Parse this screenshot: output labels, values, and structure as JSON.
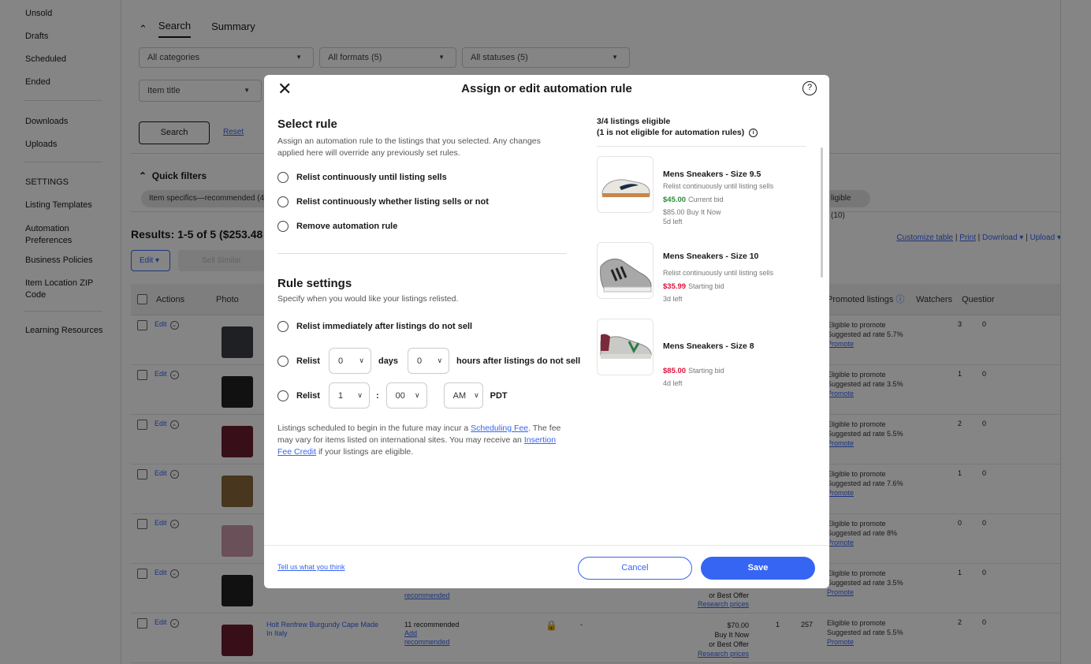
{
  "sidebar": {
    "items": [
      "Unsold",
      "Drafts",
      "Scheduled",
      "Ended"
    ],
    "items2": [
      "Downloads",
      "Uploads"
    ],
    "settings_heading": "SETTINGS",
    "settings": [
      "Listing Templates",
      "Automation Preferences",
      "Business Policies",
      "Item Location ZIP Code"
    ],
    "learning": "Learning Resources"
  },
  "main": {
    "tabs": [
      "Search",
      "Summary"
    ],
    "category": "All categories",
    "formats": "All formats (5)",
    "statuses": "All statuses (5)",
    "field": "Item title",
    "search_button": "Search",
    "reset": "Reset",
    "quick_filters": "Quick filters",
    "chip_left": "Item specifics—recommended (4",
    "chip_right": "ligible (10)",
    "results": "Results: 1-5 of 5 ($253.48",
    "edit_menu": "Edit",
    "sell_similar": "Sell Similar",
    "right_links": {
      "customize": "Customize table",
      "print": "Print",
      "download": "Download",
      "upload": "Upload"
    },
    "columns": {
      "actions": "Actions",
      "photo": "Photo",
      "promoted": "Promoted listings",
      "watchers": "Watchers",
      "questions": "Questior"
    },
    "rows": [
      {
        "edit": "Edit",
        "p1": "Eligible to promote",
        "p2": "Suggested ad rate 5.7%",
        "p3": "Promote",
        "w": "3",
        "q": "0"
      },
      {
        "edit": "Edit",
        "p1": "Eligible to promote",
        "p2": "Suggested ad rate 3.5%",
        "p3": "Promote",
        "w": "1",
        "q": "0"
      },
      {
        "edit": "Edit",
        "p1": "Eligible to promote",
        "p2": "Suggested ad rate 5.5%",
        "p3": "Promote",
        "w": "2",
        "q": "0"
      },
      {
        "edit": "Edit",
        "p1": "Eligible to promote",
        "p2": "Suggested ad rate 7.6%",
        "p3": "Promote",
        "w": "1",
        "q": "0"
      },
      {
        "edit": "Edit",
        "p1": "Eligible to promote",
        "p2": "Suggested ad rate 8%",
        "p3": "Promote",
        "w": "0",
        "q": "0"
      },
      {
        "edit": "Edit",
        "p1": "Eligible to promote",
        "p2": "Suggested ad rate 3.5%",
        "p3": "Promote",
        "w": "1",
        "q": "0"
      },
      {
        "edit": "Edit",
        "p1": "Eligible to promote",
        "p2": "Suggested ad rate 5.5%",
        "p3": "Promote",
        "w": "2",
        "q": "0"
      }
    ],
    "row6_extra": {
      "rec": "recommended",
      "best": "or Best Offer",
      "research": "Research prices"
    },
    "row7": {
      "title": "Holt Renfrew Burgundy Cape Made In Italy",
      "rec": "11 recommended",
      "add": "Add",
      "rec2": "recommended",
      "dash": "-",
      "price": "$70.00",
      "bin": "Buy It Now",
      "best": "or Best Offer",
      "research": "Research prices",
      "n1": "1",
      "n2": "257"
    }
  },
  "modal": {
    "title": "Assign or edit automation rule",
    "select_rule": {
      "heading": "Select rule",
      "desc": "Assign an automation rule to the listings that you selected. Any changes applied here will override any previously set rules.",
      "options": [
        "Relist continuously until listing sells",
        "Relist continuously whether listing sells or not",
        "Remove automation rule"
      ]
    },
    "rule_settings": {
      "heading": "Rule settings",
      "desc": "Specify when you would like your listings relisted.",
      "opt1": "Relist immediately after listings do not sell",
      "relist": "Relist",
      "days_val": "0",
      "days": "days",
      "hours_val": "0",
      "hours_after": "hours after listings do not sell",
      "hour_val": "1",
      "colon": ":",
      "min_val": "00",
      "ampm": "AM",
      "tz": "PDT"
    },
    "fee": {
      "t1": "Listings scheduled to begin in the future may incur a ",
      "link1": "Scheduling Fee",
      "t2": ". The fee may vary for items listed on international sites. You may receive an ",
      "link2": "Insertion Fee Credit",
      "t3": " if your listings are eligible."
    },
    "eligible": {
      "line1": "3/4 listings eligible",
      "line2": "(1 is not eligible for automation rules)"
    },
    "products": [
      {
        "name": "Mens Sneakers - Size 9.5",
        "status": "Relist continuously until listing sells",
        "price": "$45.00",
        "price_type": "Current bid",
        "bin": "$85.00 Buy It Now",
        "left": "5d left",
        "color": "#2e8b3a"
      },
      {
        "name": "Mens Sneakers - Size 10",
        "status": "Relist continuously until listing sells",
        "price": "$35.99",
        "price_type": "Starting bid",
        "left": "3d left",
        "color": "#e0103a"
      },
      {
        "name": "Mens Sneakers - Size 8",
        "price": "$85.00",
        "price_type": "Starting bid",
        "left": "4d left",
        "color": "#e0103a"
      }
    ],
    "footer": {
      "feedback": "Tell us what you think",
      "cancel": "Cancel",
      "save": "Save"
    }
  }
}
